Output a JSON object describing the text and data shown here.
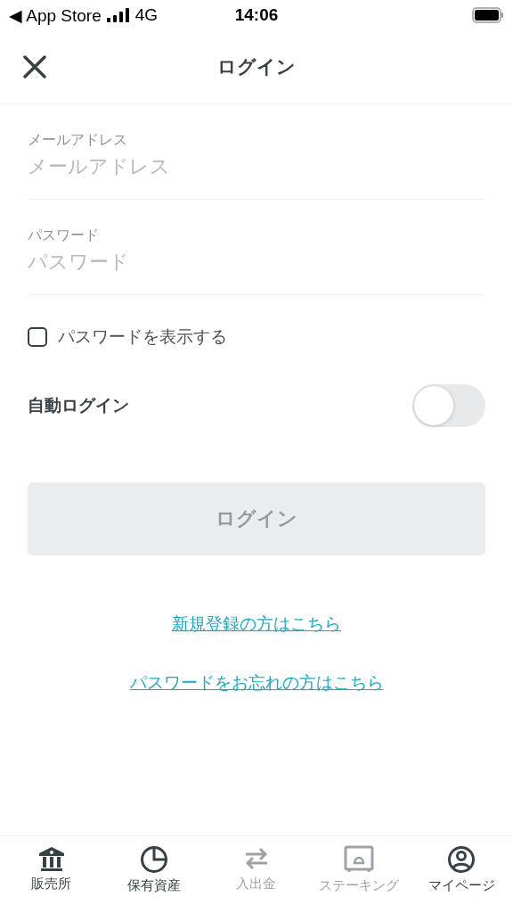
{
  "status_bar": {
    "back": "◀ App Store",
    "carrier": "4G",
    "time": "14:06"
  },
  "header": {
    "title": "ログイン"
  },
  "fields": [
    {
      "label": "メールアドレス",
      "placeholder": "メールアドレス"
    },
    {
      "label": "パスワード",
      "placeholder": "パスワード"
    }
  ],
  "show_password": {
    "label": "パスワードを表示する",
    "checked": false
  },
  "auto_login": {
    "label": "自動ログイン",
    "on": false
  },
  "login_button": {
    "label": "ログイン",
    "disabled": true
  },
  "links": [
    "新規登録の方はこちら",
    "パスワードをお忘れの方はこちら"
  ],
  "tab_bar": [
    {
      "kind": "bank",
      "label": "販売所",
      "disabled": false
    },
    {
      "kind": "pie",
      "label": "保有資産",
      "disabled": false
    },
    {
      "kind": "transfer",
      "label": "入出金",
      "disabled": true
    },
    {
      "kind": "safe",
      "label": "ステーキング",
      "disabled": true
    },
    {
      "kind": "person",
      "label": "マイページ",
      "disabled": false
    }
  ]
}
